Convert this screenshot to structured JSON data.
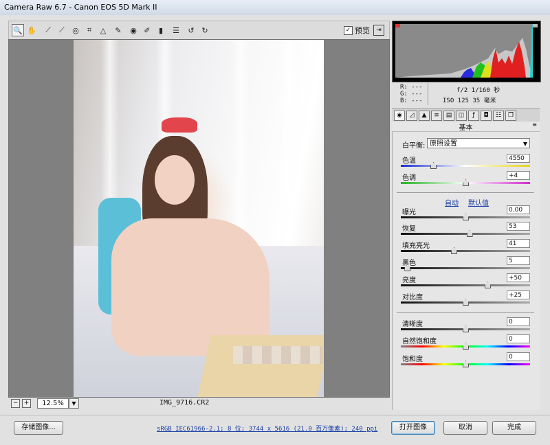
{
  "window": {
    "title": "Camera Raw 6.7  -  Canon EOS 5D Mark II"
  },
  "toolbar": {
    "tools": [
      "zoom-icon",
      "hand-icon",
      "white-balance-icon",
      "color-sampler-icon",
      "target-adjust-icon",
      "crop-icon",
      "straighten-icon",
      "spot-removal-icon",
      "red-eye-icon",
      "adjustment-brush-icon",
      "graduated-filter-icon",
      "preferences-icon",
      "rotate-ccw-icon",
      "rotate-cw-icon"
    ],
    "preview_label": "预览",
    "preview_checked": "✓"
  },
  "image": {
    "filename": "IMG_9716.CR2",
    "zoom": "12.5%"
  },
  "info": {
    "r": "R:  ---",
    "g": "G:  ---",
    "b": "B:  ---",
    "exposure": "f/2   1/160 秒",
    "iso": "ISO 125   35 毫米"
  },
  "panel": {
    "title": "基本",
    "white_balance_label": "白平衡:",
    "white_balance_value": "原照设置",
    "auto_link": "自动",
    "default_link": "默认值",
    "sliders": [
      {
        "label": "色温",
        "value": "4550",
        "pos": 0.25
      },
      {
        "label": "色调",
        "value": "+4",
        "pos": 0.5
      },
      {
        "label": "曝光",
        "value": "0.00",
        "pos": 0.5
      },
      {
        "label": "恢复",
        "value": "53",
        "pos": 0.53
      },
      {
        "label": "填充亮光",
        "value": "41",
        "pos": 0.41
      },
      {
        "label": "黑色",
        "value": "5",
        "pos": 0.05
      },
      {
        "label": "亮度",
        "value": "+50",
        "pos": 0.67
      },
      {
        "label": "对比度",
        "value": "+25",
        "pos": 0.5
      },
      {
        "label": "清晰度",
        "value": "0",
        "pos": 0.5
      },
      {
        "label": "自然饱和度",
        "value": "0",
        "pos": 0.5
      },
      {
        "label": "饱和度",
        "value": "0",
        "pos": 0.5
      }
    ]
  },
  "bottom": {
    "save_label": "存储图像...",
    "meta": "sRGB IEC61966-2.1; 8 位; 3744 x 5616 (21.0 百万像素); 240 ppi",
    "open_label": "打开图像",
    "cancel_label": "取消",
    "done_label": "完成"
  },
  "colors": {
    "accent": "#1a3fa6",
    "clip_shadow": "#d33333"
  }
}
